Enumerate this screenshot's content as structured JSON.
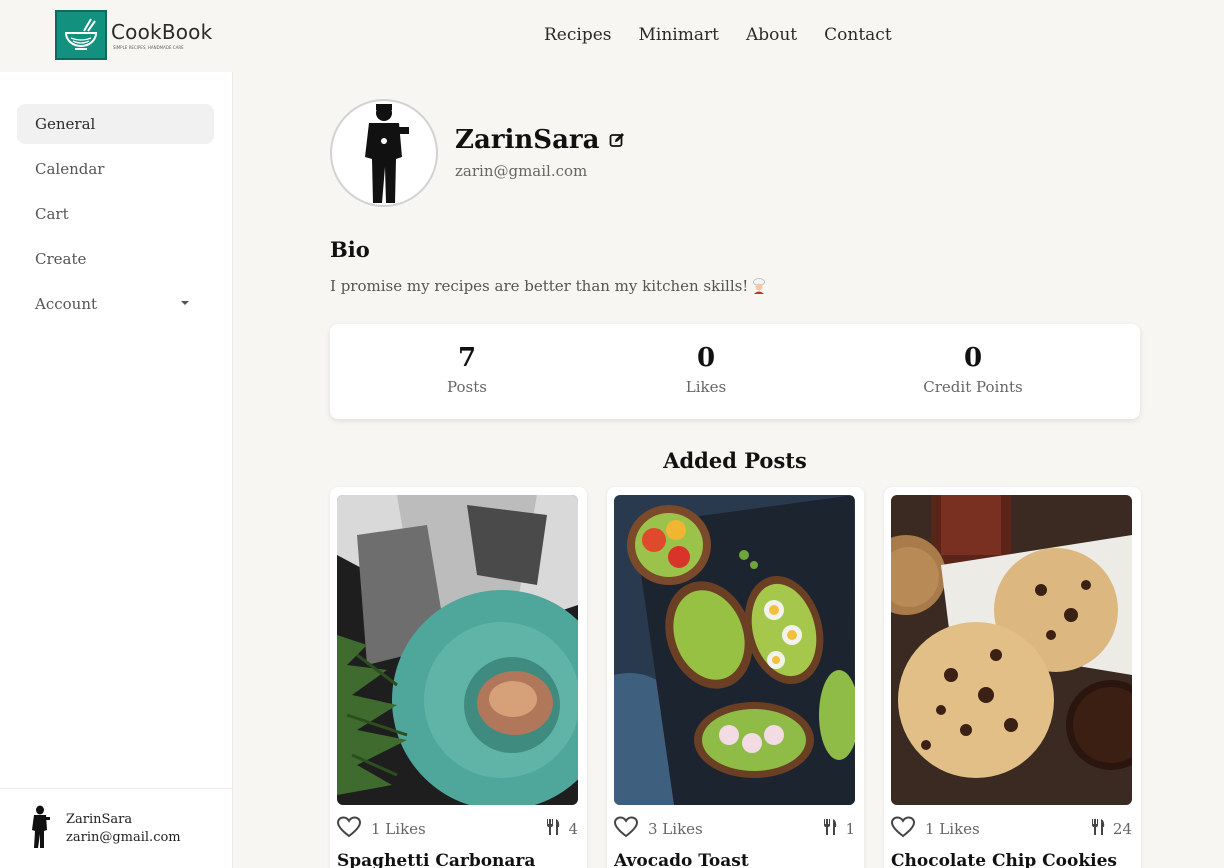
{
  "app": {
    "logo_name": "CookBook",
    "logo_tagline": "SIMPLE RECIPES, HANDMADE CARE",
    "brand_color": "#12927e"
  },
  "nav": {
    "items": [
      "Recipes",
      "Minimart",
      "About",
      "Contact"
    ]
  },
  "sidebar": {
    "items": [
      {
        "label": "General",
        "active": true
      },
      {
        "label": "Calendar",
        "active": false
      },
      {
        "label": "Cart",
        "active": false
      },
      {
        "label": "Create",
        "active": false
      },
      {
        "label": "Account",
        "active": false
      }
    ],
    "user": {
      "name": "ZarinSara",
      "email": "zarin@gmail.com"
    }
  },
  "profile": {
    "name": "ZarinSara",
    "email": "zarin@gmail.com",
    "bio_title": "Bio",
    "bio_text": "I promise my recipes are better than my kitchen skills!"
  },
  "stats": [
    {
      "value": "7",
      "label": "Posts"
    },
    {
      "value": "0",
      "label": "Likes"
    },
    {
      "value": "0",
      "label": "Credit Points"
    }
  ],
  "posts_section": {
    "title": "Added Posts",
    "posts": [
      {
        "title": "Spaghetti Carbonara",
        "likes": "1 Likes",
        "servings": "4",
        "image": "pasta-plate-photo"
      },
      {
        "title": "Avocado Toast",
        "likes": "3 Likes",
        "servings": "1",
        "image": "avocado-toast-photo"
      },
      {
        "title": "Chocolate Chip Cookies",
        "likes": "1 Likes",
        "servings": "24",
        "image": "cookies-photo"
      }
    ]
  },
  "icons": {
    "logo": "bowl-noodles-icon",
    "edit": "edit-icon",
    "bio_emoji": "chef-emoji-icon",
    "like": "heart-icon",
    "servings": "fork-knife-icon",
    "dropdown": "caret-down-icon"
  }
}
